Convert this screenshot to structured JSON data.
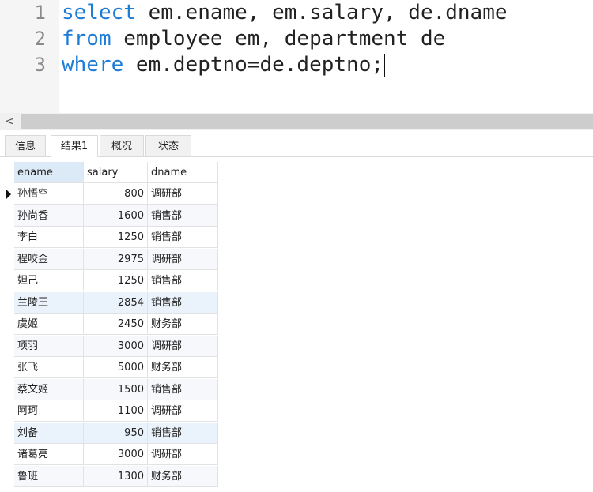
{
  "editor": {
    "lines": [
      {
        "num": "1",
        "kw": "select",
        "rest": " em.ename, em.salary, de.dname"
      },
      {
        "num": "2",
        "kw": "from",
        "rest": " employee em, department de"
      },
      {
        "num": "3",
        "kw": "where",
        "rest": " em.deptno=de.deptno;"
      }
    ]
  },
  "scrollbar": {
    "left_arrow": "<"
  },
  "tabs": [
    {
      "label": "信息",
      "active": false
    },
    {
      "label": "结果1",
      "active": true
    },
    {
      "label": "概况",
      "active": false
    },
    {
      "label": "状态",
      "active": false
    }
  ],
  "grid": {
    "columns": [
      "ename",
      "salary",
      "dname"
    ],
    "rows": [
      [
        "孙悟空",
        "800",
        "调研部"
      ],
      [
        "孙尚香",
        "1600",
        "销售部"
      ],
      [
        "李白",
        "1250",
        "销售部"
      ],
      [
        "程咬金",
        "2975",
        "调研部"
      ],
      [
        "妲己",
        "1250",
        "销售部"
      ],
      [
        "兰陵王",
        "2854",
        "销售部"
      ],
      [
        "虞姬",
        "2450",
        "财务部"
      ],
      [
        "项羽",
        "3000",
        "调研部"
      ],
      [
        "张飞",
        "5000",
        "财务部"
      ],
      [
        "蔡文姬",
        "1500",
        "销售部"
      ],
      [
        "阿珂",
        "1100",
        "调研部"
      ],
      [
        "刘备",
        "950",
        "销售部"
      ],
      [
        "诸葛亮",
        "3000",
        "调研部"
      ],
      [
        "鲁班",
        "1300",
        "财务部"
      ]
    ],
    "current_row": 0,
    "selected_column": 0
  },
  "colors": {
    "keyword": "#1f7cd6",
    "header_selected": "#dce9f7"
  }
}
